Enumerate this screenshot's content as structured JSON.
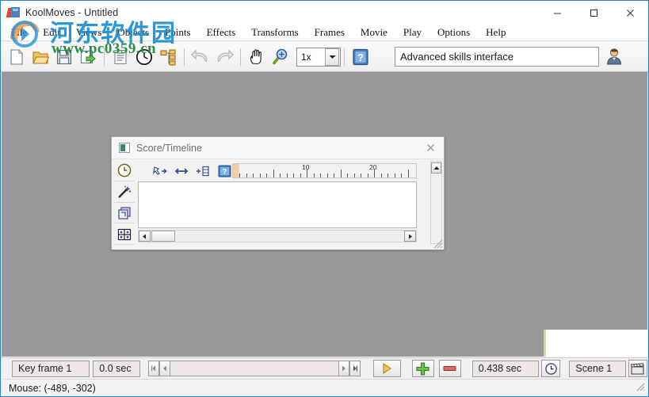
{
  "window": {
    "title": "KoolMoves - Untitled",
    "app_icon": "koolmoves-icon",
    "controls": {
      "minimize": "minimize-icon",
      "maximize": "maximize-icon",
      "close": "close-icon"
    }
  },
  "menubar": {
    "items": [
      {
        "label": "File"
      },
      {
        "label": "Edit"
      },
      {
        "label": "Views"
      },
      {
        "label": "Objects"
      },
      {
        "label": "Points"
      },
      {
        "label": "Effects"
      },
      {
        "label": "Transforms"
      },
      {
        "label": "Frames"
      },
      {
        "label": "Movie"
      },
      {
        "label": "Play"
      },
      {
        "label": "Options"
      },
      {
        "label": "Help"
      }
    ]
  },
  "toolbar": {
    "buttons": [
      {
        "name": "new-file-icon"
      },
      {
        "name": "open-folder-icon"
      },
      {
        "name": "save-icon"
      },
      {
        "name": "export-icon"
      },
      {
        "name": "list-icon"
      },
      {
        "name": "clock-icon"
      },
      {
        "name": "hierarchy-icon"
      },
      {
        "name": "undo-icon"
      },
      {
        "name": "redo-icon"
      },
      {
        "name": "hand-pan-icon"
      },
      {
        "name": "zoom-magnifier-icon"
      }
    ],
    "zoom_level": "1x",
    "help_icon": "help-book-icon",
    "search_value": "Advanced skills interface",
    "search_placeholder": "",
    "user_icon": "user-avatar-icon"
  },
  "score_window": {
    "title": "Score/Timeline",
    "title_icon": "score-window-icon",
    "close_icon": "close-icon",
    "side_buttons": [
      {
        "name": "timeline-clock-icon"
      },
      {
        "name": "magic-wand-icon"
      },
      {
        "name": "layers-icon"
      },
      {
        "name": "grid-icon"
      }
    ],
    "tool_buttons": [
      {
        "name": "move-node-icon"
      },
      {
        "name": "stretch-horizontal-icon"
      },
      {
        "name": "add-frame-icon"
      },
      {
        "name": "help-icon"
      }
    ],
    "ruler": {
      "labels": [
        "10",
        "20"
      ],
      "label_positions": [
        10,
        20
      ],
      "major_every": 5,
      "tick_count": 26,
      "start_marker": true
    },
    "hscroll": {
      "left_arrow": "arrow-left-icon",
      "right_arrow": "arrow-right-icon"
    },
    "vscroll": {
      "up_arrow": "arrow-up-icon"
    }
  },
  "control_bar": {
    "keyframe_label": "Key frame 1",
    "time_label": "0.0 sec",
    "nav_first": "nav-first-icon",
    "nav_prev": "nav-prev-icon",
    "nav_next": "nav-next-icon",
    "nav_last": "nav-last-icon",
    "play": "play-icon",
    "add": "add-frame-plus-icon",
    "remove": "remove-frame-minus-icon",
    "duration": "0.438 sec",
    "duration_icon": "clock-icon",
    "scene": "Scene 1",
    "scene_icon": "clapperboard-icon"
  },
  "statusbar": {
    "mouse": "Mouse: (-489, -302)"
  },
  "watermark": {
    "site_cn": "河东软件园",
    "site_url": "www.pc0359.cn"
  },
  "colors": {
    "workspace": "#999999",
    "accent": "#2a7fc9",
    "field": "#efe7e4",
    "ruler_marker": "#f6cfa8"
  }
}
